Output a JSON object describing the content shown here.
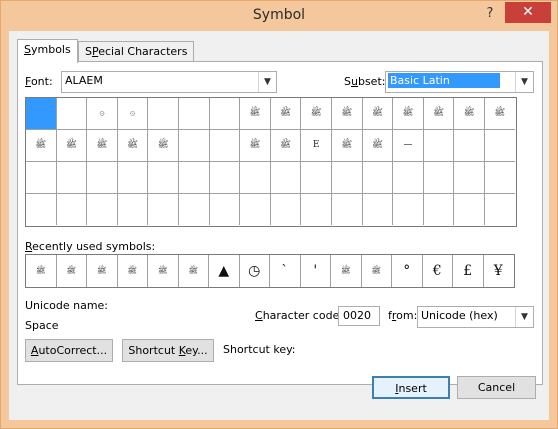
{
  "window": {
    "title": "Symbol",
    "help": "?",
    "close": "✕"
  },
  "tabs": [
    {
      "label": "Symbols",
      "accel": "S",
      "rest": "ymbols"
    },
    {
      "label": "Special Characters",
      "accel": "P",
      "pre": "S",
      "rest": "ecial Characters"
    }
  ],
  "font": {
    "label": "Font:",
    "accel": "F",
    "rest": "ont:",
    "value": "ALAEM"
  },
  "subset": {
    "label": "Subset:",
    "pre": "S",
    "accel": "u",
    "rest": "bset:",
    "value": "Basic Latin"
  },
  "grid": {
    "rows": [
      [
        "",
        "",
        "۞",
        "۞",
        "",
        "",
        "",
        "ﷺ",
        "ﷺ",
        "ﷺ",
        "ﷺ",
        "ﷺ",
        "ﷺ",
        "ﷺ",
        "ﷺ",
        "ﷺ"
      ],
      [
        "ﷺ",
        "ﷺ",
        "ﷺ",
        "ﷺ",
        "ﷺ",
        "",
        "",
        "ﷺ",
        "ﷺ",
        "E",
        "ﷺ",
        "ﷺ",
        "—",
        "",
        "",
        ""
      ],
      [
        "",
        "",
        "",
        "",
        "",
        "",
        "",
        "",
        "",
        "",
        "",
        "",
        "",
        "",
        "",
        ""
      ],
      [
        "",
        "",
        "",
        "",
        "",
        "",
        "",
        "",
        "",
        "",
        "",
        "",
        "",
        "",
        "",
        ""
      ]
    ],
    "selected_index": 0
  },
  "recent": {
    "label": "Recently used symbols:",
    "accel": "R",
    "rest": "ecently used symbols:",
    "items": [
      "ﷺ",
      "ﷺ",
      "ﷺ",
      "ﷺ",
      "ﷺ",
      "ﷺ",
      "▲",
      "◷",
      "`",
      "'",
      "ﷺ",
      "ﷺ",
      "°",
      "€",
      "£",
      "¥"
    ]
  },
  "unicode_name": {
    "label": "Unicode name:",
    "value": "Space"
  },
  "char_code": {
    "label": "Character code:",
    "accel": "C",
    "rest": "haracter code:",
    "value": "0020"
  },
  "from": {
    "label": "from:",
    "pre": "f",
    "accel": "r",
    "rest": "om:",
    "value": "Unicode (hex)"
  },
  "buttons": {
    "autocorrect": "AutoCorrect...",
    "autocorrect_accel": "A",
    "autocorrect_rest": "utoCorrect...",
    "shortcut": "Shortcut Key...",
    "shortcut_pre": "Shortcut ",
    "shortcut_accel": "K",
    "shortcut_rest": "ey...",
    "insert": "Insert",
    "insert_accel": "I",
    "insert_rest": "nsert",
    "cancel": "Cancel"
  },
  "shortcut_key_label": "Shortcut key:"
}
